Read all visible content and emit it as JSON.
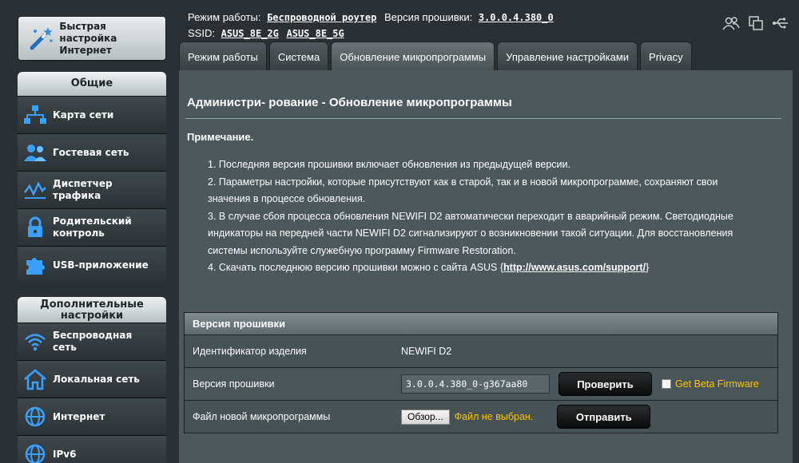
{
  "quick_setup": {
    "label_line1": "Быстрая настройка",
    "label_line2": "Интернет",
    "icon": "magic-wand-icon"
  },
  "sidebar": {
    "general_header": "Общие",
    "general_items": [
      {
        "label_line1": "Карта сети",
        "label_line2": "",
        "icon": "network-map-icon"
      },
      {
        "label_line1": "Гостевая сеть",
        "label_line2": "",
        "icon": "guest-network-icon"
      },
      {
        "label_line1": "Диспетчер",
        "label_line2": "трафика",
        "icon": "traffic-manager-icon"
      },
      {
        "label_line1": "Родительский",
        "label_line2": "контроль",
        "icon": "parental-lock-icon"
      },
      {
        "label_line1": "USB-приложение",
        "label_line2": "",
        "icon": "puzzle-icon"
      }
    ],
    "advanced_header_line1": "Дополнительные",
    "advanced_header_line2": "настройки",
    "advanced_items": [
      {
        "label_line1": "Беспроводная",
        "label_line2": "сеть",
        "icon": "wifi-icon"
      },
      {
        "label_line1": "Локальная сеть",
        "label_line2": "",
        "icon": "home-icon"
      },
      {
        "label_line1": "Интернет",
        "label_line2": "",
        "icon": "globe-icon"
      },
      {
        "label_line1": "IPv6",
        "label_line2": "",
        "icon": "ipv6-globe-icon"
      }
    ]
  },
  "status": {
    "mode_label": "Режим работы:",
    "mode_value": "Беспроводной роутер",
    "firmware_label": "Версия прошивки:",
    "firmware_value": "3.0.0.4.380_0",
    "ssid_label": "SSID:",
    "ssid_1": "ASUS_8E_2G",
    "ssid_2": "ASUS_8E_5G"
  },
  "top_icons": [
    "users-icon",
    "copy-icon",
    "usb-icon"
  ],
  "tabs": [
    {
      "label": "Режим работы"
    },
    {
      "label": "Система"
    },
    {
      "label": "Обновление микропрограммы"
    },
    {
      "label": "Управление настройками"
    },
    {
      "label": "Privacy"
    }
  ],
  "main": {
    "title": "Администри- рование - Обновление микропрограммы",
    "note_title": "Примечание.",
    "notes": [
      {
        "line1": "1. Последняя версия прошивки включает обновления из предыдущей версии."
      },
      {
        "line1": "2. Параметры настройки, которые присутствуют как в старой, так и в новой микропрограмме, сохраняют свои",
        "line2": "значения в процессе обновления."
      },
      {
        "line1": "3. В случае сбоя процесса обновления NEWIFI D2 автоматически переходит в аварийный режим. Светодиодные",
        "line2": "индикаторы на передней части NEWIFI D2 сигнализируют о возникновении такой ситуации. Для восстановления",
        "line3": "системы используйте служебную программу Firmware Restoration."
      },
      {
        "line1_prefix": "4. Скачать последнюю версию прошивки можно с сайта ASUS",
        "link": "http://www.asus.com/support/"
      }
    ],
    "firmware_section": {
      "header": "Версия прошивки",
      "rows": {
        "product_id_label": "Идентификатор изделия",
        "product_id_value": "NEWIFI D2",
        "version_label": "Версия прошивки",
        "version_value": "3.0.0.4.380_0-g367aa80",
        "check_button": "Проверить",
        "beta_label": "Get Beta Firmware",
        "file_label": "Файл новой микропрограммы",
        "browse_button": "Обзор...",
        "no_file": "Файл не выбран.",
        "upload_button": "Отправить"
      }
    }
  },
  "colors": {
    "accent_yellow": "#f7c500",
    "panel_bg": "#4d585c",
    "page_bg": "#2a3033"
  }
}
